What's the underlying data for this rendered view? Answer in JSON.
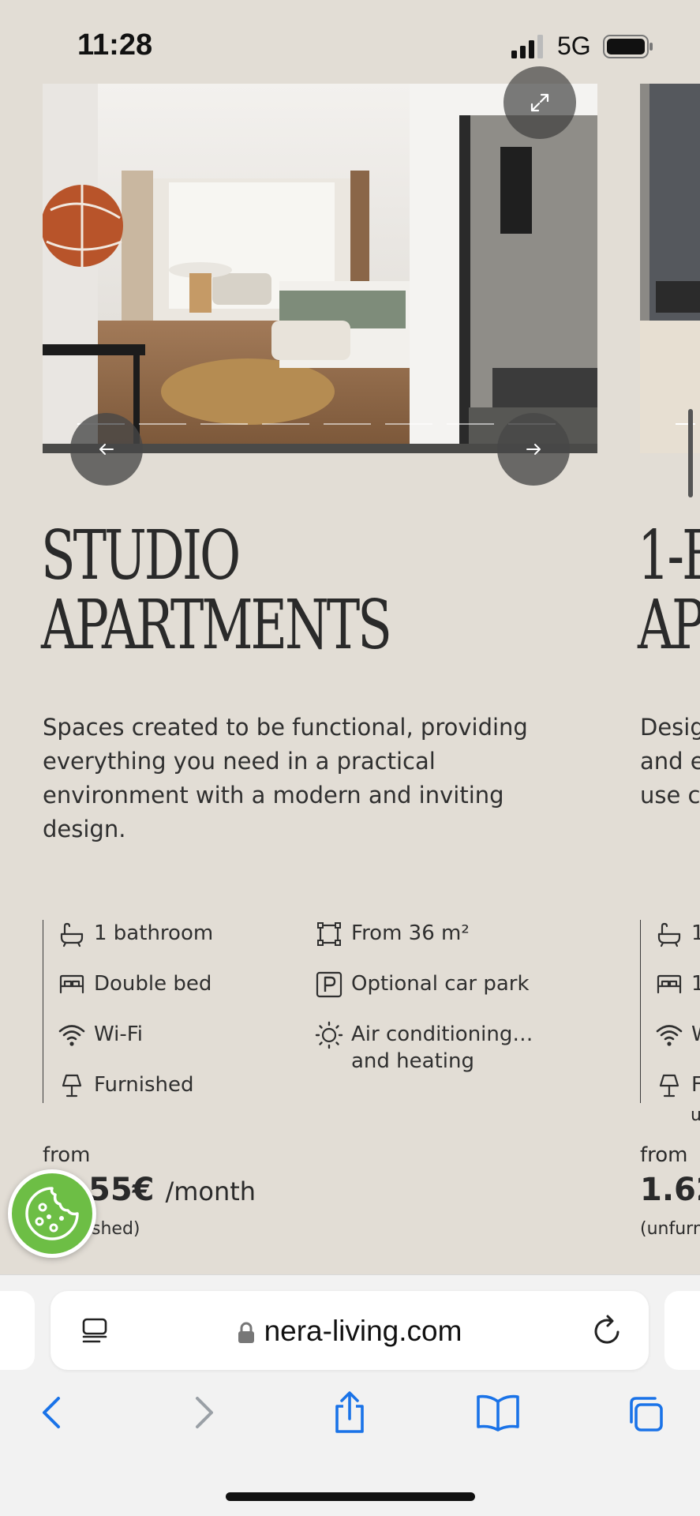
{
  "status_bar": {
    "time": "11:28",
    "network": "5G"
  },
  "gallery": {
    "dot_count": 9,
    "active_dot": 0
  },
  "card": {
    "title_line1": "STUDIO",
    "title_line2": "APARTMENTS",
    "description": "Spaces created to be functional, providing everything you need in a practical environment with a modern and inviting design.",
    "features": [
      {
        "icon": "bathtub-icon",
        "label": "1 bathroom"
      },
      {
        "icon": "bed-icon",
        "label": "Double bed"
      },
      {
        "icon": "wifi-icon",
        "label": "Wi-Fi"
      },
      {
        "icon": "lamp-icon",
        "label": "Furnished"
      },
      {
        "icon": "area-icon",
        "label": "From 36 m²"
      },
      {
        "icon": "parking-icon",
        "label": "Optional car park"
      },
      {
        "icon": "sun-icon",
        "label": "Air conditioning… and heating"
      }
    ],
    "from_label": "from",
    "price": "55€",
    "per_month": "/month",
    "note": "shed)"
  },
  "next_card": {
    "title_line1": "1-B",
    "title_line2": "AP",
    "description_lines": [
      "Desig",
      "and e",
      "use c"
    ],
    "feature_labels": [
      "1",
      "1",
      "W",
      "F",
      "u"
    ],
    "from_label": "from",
    "price": "1.62",
    "note": "(unfurn"
  },
  "browser": {
    "url": "nera-living.com"
  },
  "colors": {
    "page_bg": "#e2ddd5",
    "text": "#2a2a2a",
    "cookie_green": "#6dbe45",
    "ios_blue": "#1a73e8"
  }
}
